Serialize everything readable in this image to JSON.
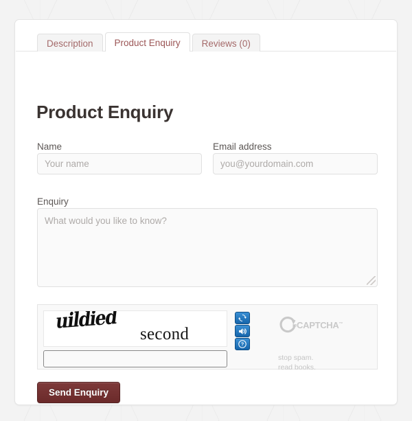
{
  "tabs": [
    {
      "label": "Description",
      "active": false
    },
    {
      "label": "Product Enquiry",
      "active": true
    },
    {
      "label": "Reviews (0)",
      "active": false
    }
  ],
  "page": {
    "title": "Product Enquiry"
  },
  "form": {
    "name": {
      "label": "Name",
      "placeholder": "Your name",
      "value": ""
    },
    "email": {
      "label": "Email address",
      "placeholder": "you@yourdomain.com",
      "value": ""
    },
    "enquiry": {
      "label": "Enquiry",
      "placeholder": "What would you like to know?",
      "value": ""
    },
    "submit_label": "Send Enquiry"
  },
  "captcha": {
    "word_1": "uildied",
    "word_2": "second",
    "answer_value": "",
    "answer_placeholder": "",
    "brand_prefix": "re",
    "brand_name": "CAPTCHA",
    "brand_tm": "™",
    "tagline_line_1": "stop spam.",
    "tagline_line_2": "read books.",
    "buttons": [
      {
        "name": "refresh-icon",
        "title": "Get a new challenge"
      },
      {
        "name": "audio-icon",
        "title": "Get an audio challenge"
      },
      {
        "name": "help-icon",
        "title": "Help"
      }
    ]
  },
  "colors": {
    "tab_text": "#a46a6a",
    "heading": "#3a3331",
    "button_bg": "#6b2a2a",
    "captcha_button_blue": "#1565ab",
    "recaptcha_gray": "#c9c9c9"
  }
}
